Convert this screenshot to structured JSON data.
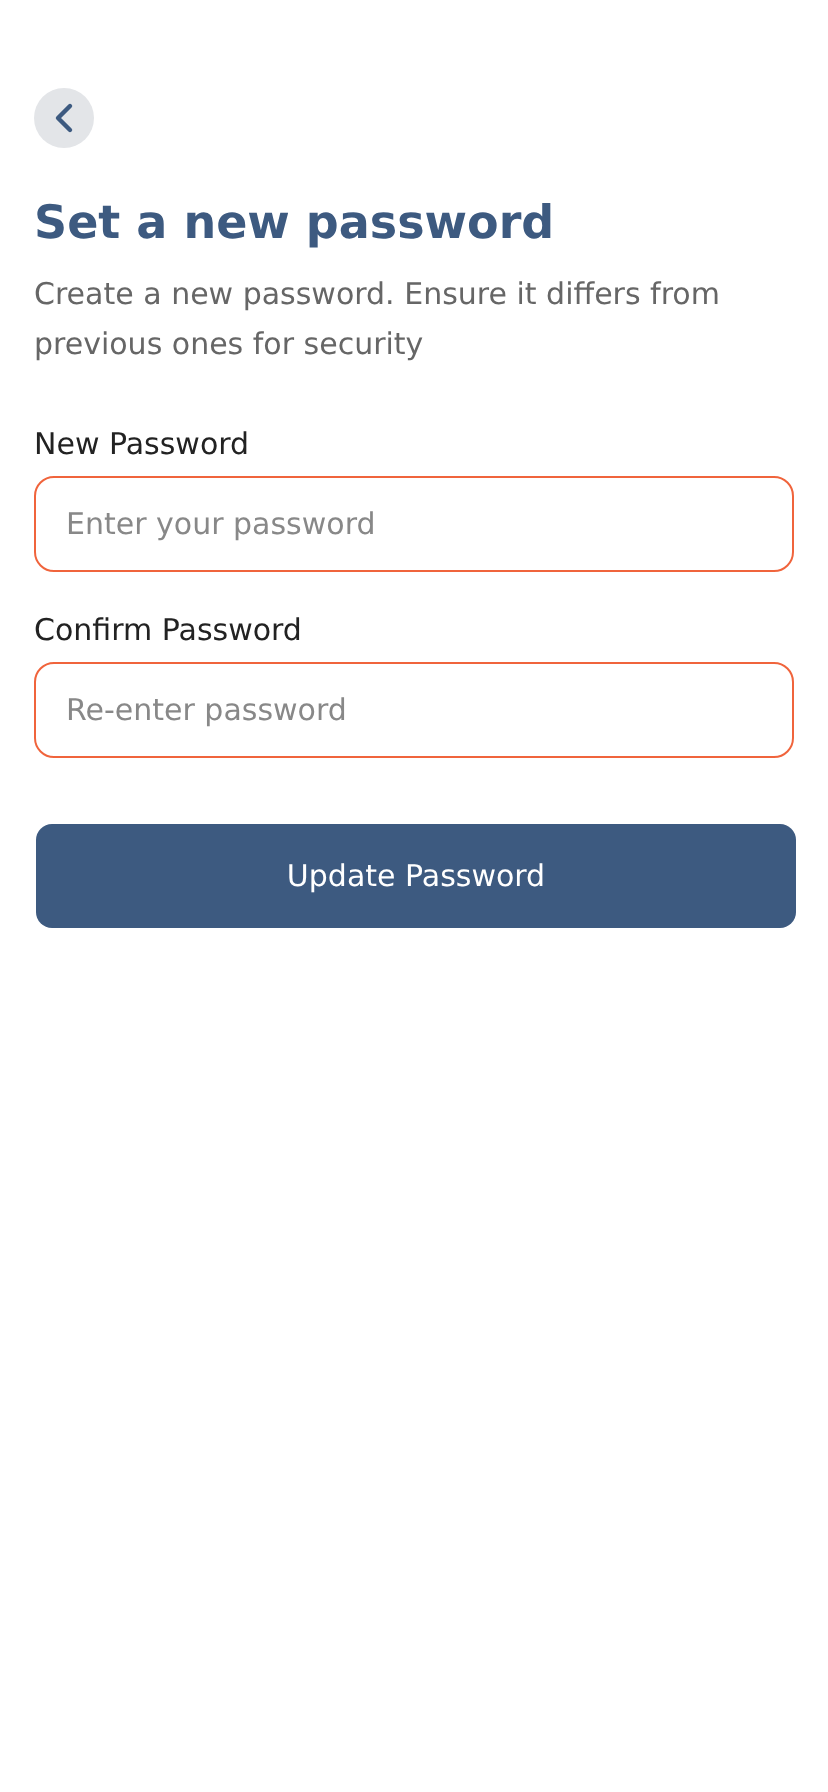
{
  "title": "Set a new password",
  "subtitle": "Create a new password. Ensure it differs from previous ones for security",
  "fields": [
    {
      "label": "New Password",
      "placeholder": "Enter your password",
      "error": true
    },
    {
      "label": "Confirm Password",
      "placeholder": "Re-enter password",
      "error": true
    }
  ],
  "button": "Update Password"
}
